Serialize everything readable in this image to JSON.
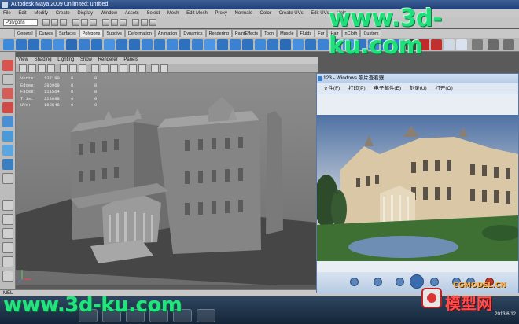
{
  "window": {
    "title": "Autodesk Maya 2009 Unlimited: untitled"
  },
  "menubar": {
    "items": [
      "File",
      "Edit",
      "Modify",
      "Create",
      "Display",
      "Window",
      "Assets",
      "Select",
      "Mesh",
      "Edit Mesh",
      "Proxy",
      "Normals",
      "Color",
      "Create UVs",
      "Edit UVs",
      "Help"
    ]
  },
  "statusline": {
    "mode": "Polygons"
  },
  "shelf": {
    "tabs": [
      "General",
      "Curves",
      "Surfaces",
      "Polygons",
      "Subdivs",
      "Deformation",
      "Animation",
      "Dynamics",
      "Rendering",
      "PaintEffects",
      "Toon",
      "Muscle",
      "Fluids",
      "Fur",
      "Hair",
      "nCloth",
      "Custom"
    ],
    "active_tab": "Polygons"
  },
  "panel": {
    "menus": [
      "View",
      "Shading",
      "Lighting",
      "Show",
      "Renderer",
      "Panels"
    ]
  },
  "hud": {
    "rows": [
      {
        "label": "Verts:",
        "value": "137180",
        "sel": "0",
        "extra": "0"
      },
      {
        "label": "Edges:",
        "value": "295969",
        "sel": "0",
        "extra": "0"
      },
      {
        "label": "Faces:",
        "value": "111564",
        "sel": "0",
        "extra": "0"
      },
      {
        "label": "Tris:",
        "value": "223098",
        "sel": "0",
        "extra": "0"
      },
      {
        "label": "UVs:",
        "value": "168546",
        "sel": "0",
        "extra": "0"
      }
    ]
  },
  "commandline": {
    "label": "MEL"
  },
  "viewer": {
    "title": "123 - Windows 照片查看器",
    "toolbar": [
      "文件(F)",
      "打印(P)",
      "电子邮件(E)",
      "刻录(U)",
      "打开(O)"
    ]
  },
  "taskbar": {
    "clock": "2013/6/12"
  },
  "watermarks": {
    "top": "www.3d-ku.com",
    "bottom": "www.3d-ku.com",
    "cg_site": "CGMODEL.CN",
    "cg_name": "模型网"
  }
}
